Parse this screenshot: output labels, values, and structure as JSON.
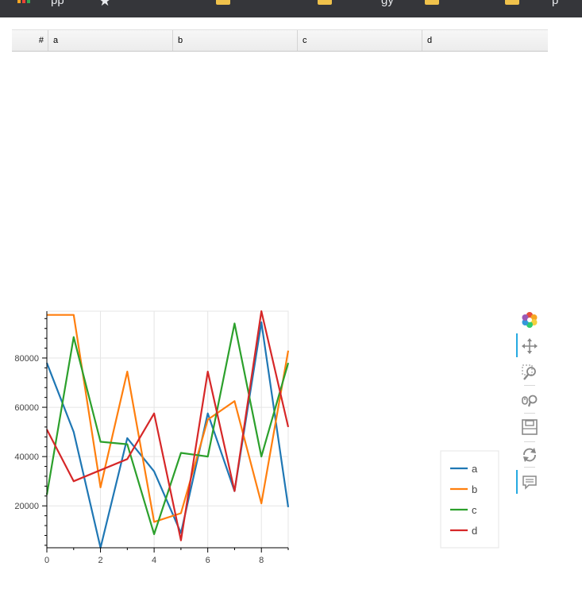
{
  "browser": {
    "bookmarks": [
      {
        "label": "pp",
        "icon": "apps-icon"
      },
      {
        "label": "",
        "icon": "star-icon"
      },
      {
        "label": "",
        "icon": "folder-icon"
      },
      {
        "label": "gy",
        "icon": "folder-icon"
      },
      {
        "label": "",
        "icon": "folder-icon"
      },
      {
        "label": "p",
        "icon": "folder-icon"
      }
    ]
  },
  "table": {
    "index_header": "#",
    "columns": [
      "a",
      "b",
      "c",
      "d"
    ]
  },
  "toolbar": {
    "tools": [
      "bokeh-logo-icon",
      "pan-icon",
      "box-zoom-icon",
      "wheel-zoom-icon",
      "save-icon",
      "reset-icon",
      "hover-icon"
    ],
    "accent": "#26aae1"
  },
  "chart_data": {
    "type": "line",
    "x": [
      0,
      1,
      2,
      3,
      4,
      5,
      6,
      7,
      8,
      9
    ],
    "series": [
      {
        "name": "a",
        "color": "#1f77b4",
        "values": [
          78000,
          50000,
          3000,
          47500,
          34000,
          9000,
          57500,
          26000,
          94500,
          19500
        ]
      },
      {
        "name": "b",
        "color": "#ff7f0e",
        "values": [
          97500,
          97500,
          27500,
          74500,
          13500,
          17000,
          55000,
          62500,
          21000,
          83000
        ]
      },
      {
        "name": "c",
        "color": "#2ca02c",
        "values": [
          24500,
          88500,
          46000,
          45000,
          8500,
          41500,
          40000,
          94000,
          40000,
          78000
        ]
      },
      {
        "name": "d",
        "color": "#d62728",
        "values": [
          51000,
          30000,
          34500,
          39000,
          57500,
          6000,
          74500,
          26000,
          99000,
          52000
        ]
      }
    ],
    "xticks": [
      "0",
      "2",
      "4",
      "6",
      "8"
    ],
    "yticks": [
      "20000",
      "40000",
      "60000",
      "80000"
    ],
    "xlim": [
      0,
      9
    ],
    "ylim": [
      3000,
      99000
    ],
    "grid": true,
    "legend_position": "right"
  }
}
